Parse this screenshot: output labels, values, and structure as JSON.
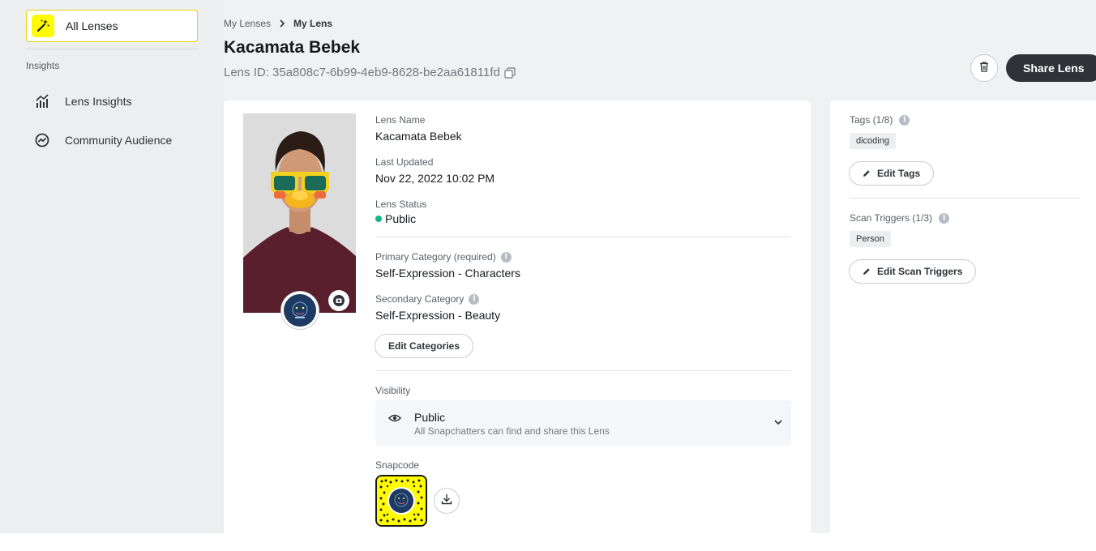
{
  "sidebar": {
    "all_lenses_label": "All Lenses",
    "section_title": "Insights",
    "items": [
      {
        "label": "Lens Insights",
        "icon": "bar-chart-icon"
      },
      {
        "label": "Community Audience",
        "icon": "trend-circle-icon"
      }
    ]
  },
  "breadcrumb": {
    "parent": "My Lenses",
    "current": "My Lens"
  },
  "header": {
    "title": "Kacamata Bebek",
    "lens_id": "Lens ID: 35a808c7-6b99-4eb9-8628-be2aa61811fd",
    "share_label": "Share Lens"
  },
  "details": {
    "lens_name_label": "Lens Name",
    "lens_name": "Kacamata Bebek",
    "last_updated_label": "Last Updated",
    "last_updated": "Nov 22, 2022 10:02 PM",
    "status_label": "Lens Status",
    "status": "Public",
    "primary_category_label": "Primary Category (required)",
    "primary_category": "Self-Expression - Characters",
    "secondary_category_label": "Secondary Category",
    "secondary_category": "Self-Expression - Beauty",
    "edit_categories_label": "Edit Categories",
    "visibility_label": "Visibility",
    "visibility_title": "Public",
    "visibility_sub": "All Snapchatters can find and share this Lens",
    "snapcode_label": "Snapcode"
  },
  "side": {
    "tags_label": "Tags (1/8)",
    "tags": [
      "dicoding"
    ],
    "edit_tags_label": "Edit Tags",
    "scan_label": "Scan Triggers (1/3)",
    "scan_triggers": [
      "Person"
    ],
    "edit_scan_label": "Edit Scan Triggers"
  },
  "colors": {
    "accent_yellow": "#fffc00",
    "status_green": "#12b886",
    "dark_button": "#2f3338"
  }
}
